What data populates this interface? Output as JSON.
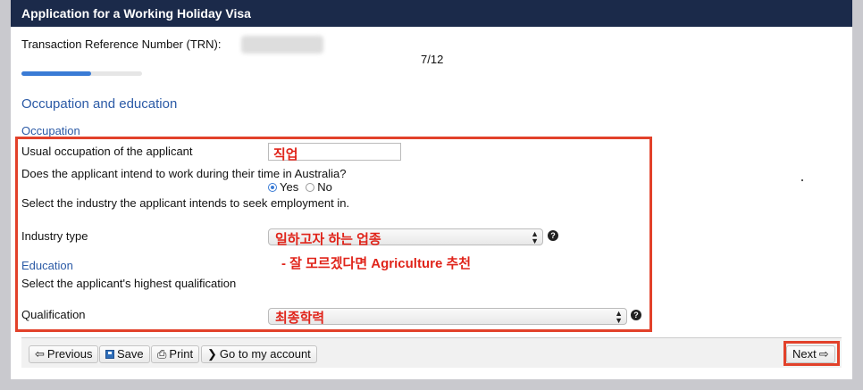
{
  "header": {
    "title": "Application for a Working Holiday Visa"
  },
  "trn": {
    "label": "Transaction Reference Number (TRN):"
  },
  "progress": {
    "page_text": "7/12",
    "fraction": 0.58
  },
  "section": {
    "title": "Occupation and education"
  },
  "occupation": {
    "heading": "Occupation",
    "usual_label": "Usual occupation of the applicant",
    "usual_annotation": "직업",
    "work_question": "Does the applicant intend to work during their time in Australia?",
    "yes_label": "Yes",
    "no_label": "No",
    "industry_instruction": "Select the industry the applicant intends to seek employment in.",
    "industry_label": "Industry type",
    "industry_annotation": "일하고자 하는 업종",
    "industry_note": "- 잘 모르겠다면 Agriculture 추천"
  },
  "education": {
    "heading": "Education",
    "instruction": "Select the applicant's highest qualification",
    "qualification_label": "Qualification",
    "qualification_annotation": "최종학력"
  },
  "footer": {
    "previous": "Previous",
    "save": "Save",
    "print": "Print",
    "account": "Go to my account",
    "next": "Next"
  },
  "icons": {
    "previous": "arrow-left-icon",
    "save": "floppy-disk-icon",
    "print": "printer-icon",
    "account": "chevron-right-icon",
    "next": "arrow-right-icon",
    "help": "question-circle-icon"
  },
  "colors": {
    "header_bg": "#1b2a4a",
    "accent": "#2b5aa6",
    "annotation": "#e0241a"
  }
}
